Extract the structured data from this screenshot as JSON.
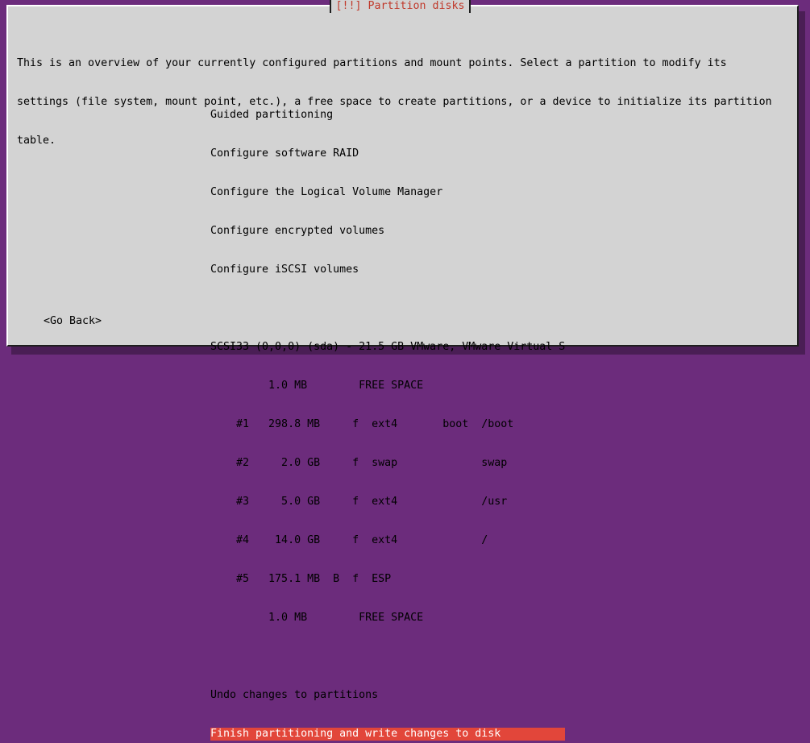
{
  "dialog": {
    "title": "[!!] Partition disks",
    "intro_lines": [
      "This is an overview of your currently configured partitions and mount points. Select a partition to modify its",
      "settings (file system, mount point, etc.), a free space to create partitions, or a device to initialize its partition",
      "table."
    ]
  },
  "menu": {
    "actions": [
      "Guided partitioning",
      "Configure software RAID",
      "Configure the Logical Volume Manager",
      "Configure encrypted volumes",
      "Configure iSCSI volumes"
    ],
    "disk": "SCSI33 (0,0,0) (sda) - 21.5 GB VMware, VMware Virtual S",
    "partitions": [
      "         1.0 MB        FREE SPACE",
      "    #1   298.8 MB     f  ext4       boot  /boot",
      "    #2     2.0 GB     f  swap             swap",
      "    #3     5.0 GB     f  ext4             /usr",
      "    #4    14.0 GB     f  ext4             /",
      "    #5   175.1 MB  B  f  ESP",
      "         1.0 MB        FREE SPACE"
    ],
    "undo": "Undo changes to partitions",
    "finish": "Finish partitioning and write changes to disk"
  },
  "buttons": {
    "go_back": "<Go Back>"
  },
  "colors": {
    "background": "#6c2c7c",
    "dialog": "#d3d3d3",
    "title": "#c0392b",
    "selection": "#e2463a"
  }
}
